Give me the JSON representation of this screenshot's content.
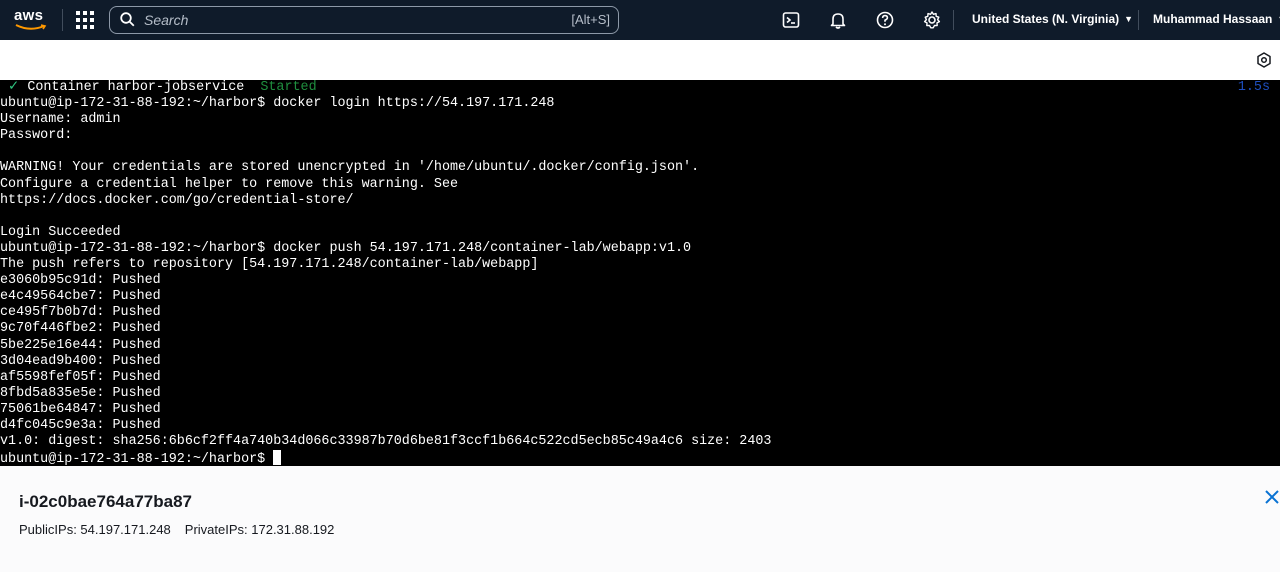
{
  "nav": {
    "logo_text": "aws",
    "search_placeholder": "Search",
    "search_shortcut": "[Alt+S]",
    "region": "United States (N. Virginia)",
    "user": "Muhammad Hassaan",
    "icons": [
      "services-grid-icon",
      "search-icon",
      "cloudshell-icon",
      "bell-icon",
      "help-icon",
      "gear-icon"
    ]
  },
  "terminal": {
    "first_line": {
      "check": "✓",
      "text": " Container harbor-jobservice  ",
      "status": "Started",
      "elapsed": "1.5s"
    },
    "lines": [
      "ubuntu@ip-172-31-88-192:~/harbor$ docker login https://54.197.171.248",
      "Username: admin",
      "Password:",
      "",
      "WARNING! Your credentials are stored unencrypted in '/home/ubuntu/.docker/config.json'.",
      "Configure a credential helper to remove this warning. See",
      "https://docs.docker.com/go/credential-store/",
      "",
      "Login Succeeded",
      "ubuntu@ip-172-31-88-192:~/harbor$ docker push 54.197.171.248/container-lab/webapp:v1.0",
      "The push refers to repository [54.197.171.248/container-lab/webapp]",
      "e3060b95c91d: Pushed",
      "e4c49564cbe7: Pushed",
      "ce495f7b0b7d: Pushed",
      "9c70f446fbe2: Pushed",
      "5be225e16e44: Pushed",
      "3d04ead9b400: Pushed",
      "af5598fef05f: Pushed",
      "8fbd5a835e5e: Pushed",
      "75061be64847: Pushed",
      "d4fc045c9e3a: Pushed",
      "v1.0: digest: sha256:6b6cf2ff4a740b34d066c33987b70d6be81f3ccf1b664c522cd5ecb85c49a4c6 size: 2403"
    ],
    "prompt": "ubuntu@ip-172-31-88-192:~/harbor$"
  },
  "instance": {
    "id": "i-02c0bae764a77ba87",
    "public_ips": "PublicIPs: 54.197.171.248",
    "private_ips": "PrivateIPs: 172.31.88.192"
  },
  "colors": {
    "nav_bg": "#0f1b2a",
    "terminal_bg": "#000000",
    "accent_link": "#0972d3",
    "started_green": "#1f8f3f",
    "elapsed_blue": "#1e4fbf"
  }
}
